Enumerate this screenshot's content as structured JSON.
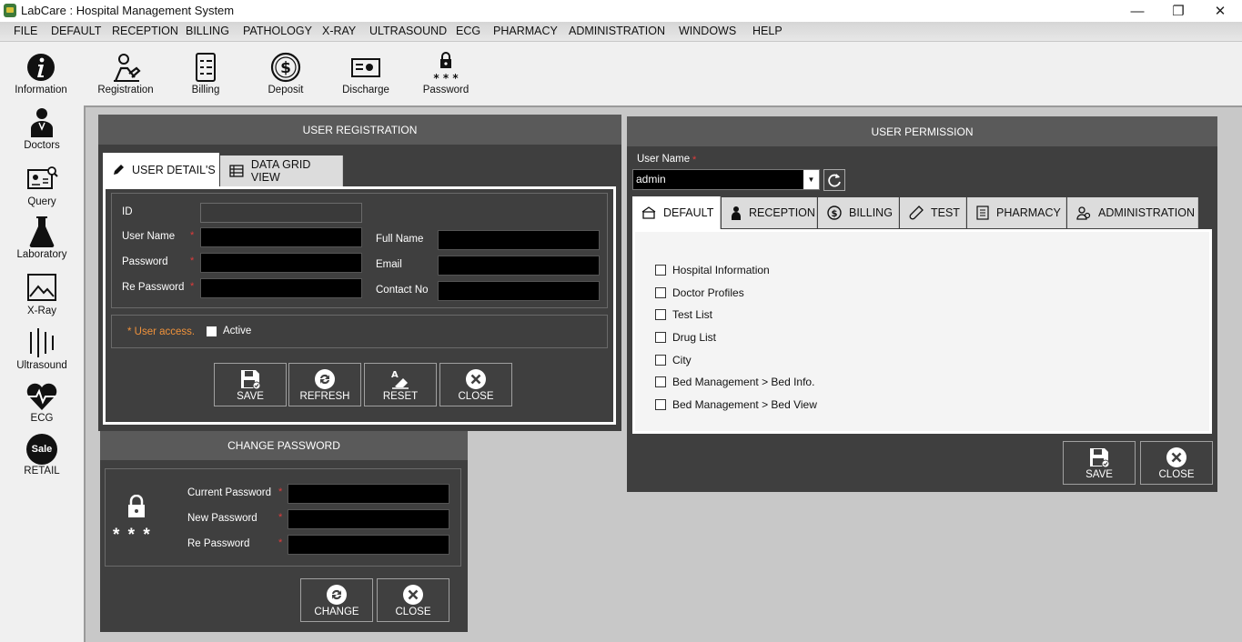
{
  "window": {
    "title": "LabCare : Hospital Management System",
    "minimize": "—",
    "restore": "❐",
    "close": "✕"
  },
  "menu": [
    "FILE",
    "DEFAULT",
    "RECEPTION",
    "BILLING",
    "PATHOLOGY",
    "X-RAY",
    "ULTRASOUND",
    "ECG",
    "PHARMACY",
    "ADMINISTRATION",
    "WINDOWS",
    "HELP"
  ],
  "toolbar": {
    "information": "Information",
    "registration": "Registration",
    "billing": "Billing",
    "deposit": "Deposit",
    "discharge": "Discharge",
    "password": "Password"
  },
  "sidebar": {
    "doctors": "Doctors",
    "query": "Query",
    "laboratory": "Laboratory",
    "xray": "X-Ray",
    "ultrasound": "Ultrasound",
    "ecg": "ECG",
    "retail": "RETAIL",
    "sale_badge": "Sale"
  },
  "user_registration": {
    "title": "USER REGISTRATION",
    "tabs": {
      "details": "USER DETAIL'S",
      "grid": "DATA GRID VIEW"
    },
    "labels": {
      "id": "ID",
      "user_name": "User Name",
      "password": "Password",
      "re_password": "Re Password",
      "full_name": "Full Name",
      "email": "Email",
      "contact_no": "Contact No"
    },
    "required_mark": "*",
    "access_label": "* User access.",
    "active_label": "Active",
    "buttons": {
      "save": "SAVE",
      "refresh": "REFRESH",
      "reset": "RESET",
      "close": "CLOSE"
    }
  },
  "change_password": {
    "title": "CHANGE PASSWORD",
    "labels": {
      "current": "Current Password",
      "new": "New Password",
      "re": "Re Password"
    },
    "stars": "* * *",
    "buttons": {
      "change": "CHANGE",
      "close": "CLOSE"
    }
  },
  "user_permission": {
    "title": "USER PERMISSION",
    "user_name_label": "User Name",
    "user_name_value": "admin",
    "tabs": {
      "default": "DEFAULT",
      "reception": "RECEPTION",
      "billing": "BILLING",
      "test": "TEST",
      "pharmacy": "PHARMACY",
      "administration": "ADMINISTRATION"
    },
    "permissions": [
      "Hospital Information",
      "Doctor Profiles",
      "Test List",
      "Drug List",
      "City",
      "Bed Management > Bed Info.",
      "Bed Management > Bed View"
    ],
    "buttons": {
      "save": "SAVE",
      "close": "CLOSE"
    }
  }
}
